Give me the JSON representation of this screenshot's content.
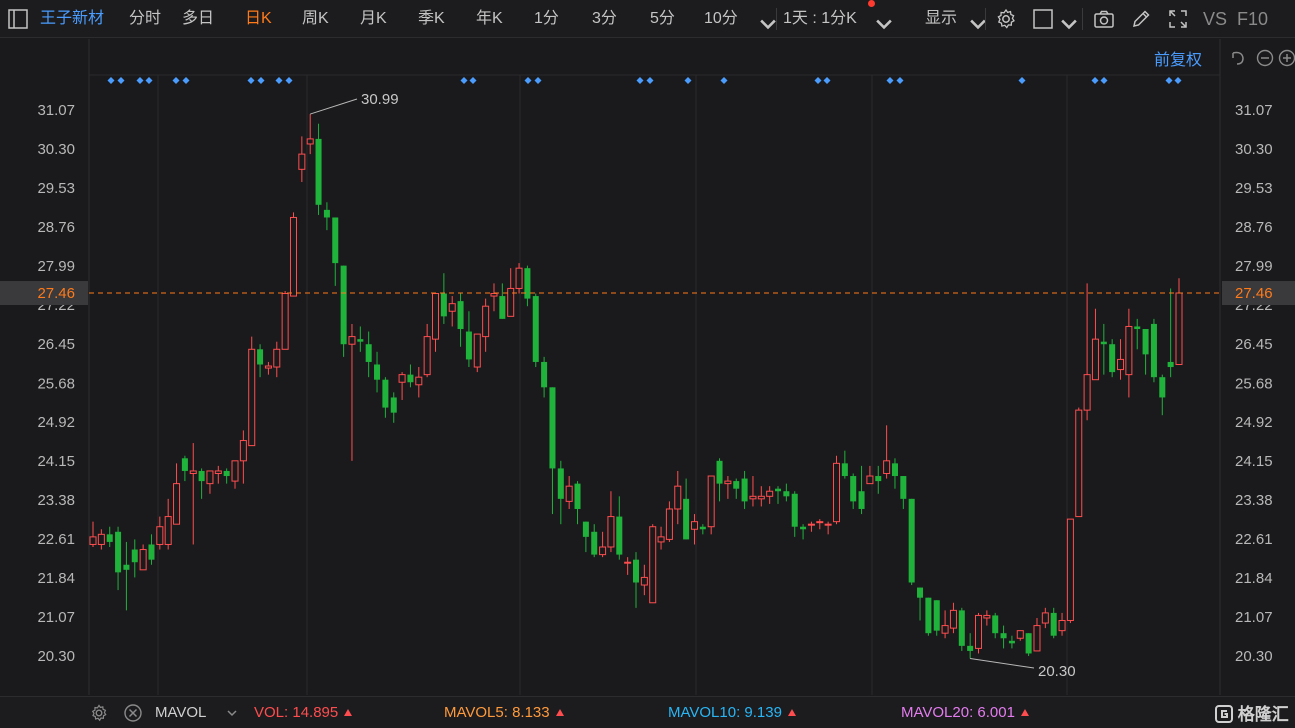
{
  "toolbar": {
    "stock_name": "王子新材",
    "tabs": [
      "分时",
      "多日",
      "日K",
      "周K",
      "月K",
      "季K",
      "年K",
      "1分",
      "3分",
      "5分",
      "10分"
    ],
    "active_tab": "日K",
    "period_select": "1天 : 1分K",
    "display_label": "显示",
    "vs_label": "VS",
    "f10_label": "F10"
  },
  "subbar": {
    "adjust_label": "前复权"
  },
  "colors": {
    "up": "#ff4d4f",
    "down": "#1fb33c",
    "accent": "#4a9cff",
    "active": "#ff7a1a",
    "price_line": "#ff7a1a"
  },
  "chart_data": {
    "type": "candlestick",
    "y_ticks": [
      "31.07",
      "30.30",
      "29.53",
      "28.76",
      "27.99",
      "27.22",
      "26.45",
      "25.68",
      "24.92",
      "24.15",
      "23.38",
      "22.61",
      "21.84",
      "21.07",
      "20.30"
    ],
    "ylim": [
      19.77,
      31.82
    ],
    "current_price": "27.46",
    "high_label": "30.99",
    "low_label": "20.30",
    "candles": [
      [
        22.5,
        22.65,
        22.45,
        22.95
      ],
      [
        22.5,
        22.7,
        22.4,
        22.8
      ],
      [
        22.7,
        22.55,
        22.45,
        22.85
      ],
      [
        22.75,
        21.95,
        21.6,
        22.85
      ],
      [
        22.1,
        22.0,
        21.2,
        22.55
      ],
      [
        22.4,
        22.15,
        21.85,
        22.6
      ],
      [
        22.0,
        22.4,
        22.0,
        22.5
      ],
      [
        22.5,
        22.2,
        22.1,
        22.7
      ],
      [
        22.5,
        22.85,
        22.4,
        23.05
      ],
      [
        22.5,
        23.05,
        22.4,
        23.4
      ],
      [
        22.9,
        23.7,
        22.9,
        24.1
      ],
      [
        24.2,
        23.95,
        23.75,
        24.25
      ],
      [
        23.9,
        23.95,
        22.5,
        24.5
      ],
      [
        23.95,
        23.75,
        23.4,
        24.0
      ],
      [
        23.7,
        23.95,
        23.5,
        23.95
      ],
      [
        23.9,
        23.95,
        23.7,
        24.05
      ],
      [
        23.95,
        23.85,
        23.7,
        24.0
      ],
      [
        23.75,
        24.15,
        23.6,
        24.15
      ],
      [
        24.15,
        24.55,
        23.7,
        24.75
      ],
      [
        24.45,
        26.35,
        24.45,
        26.6
      ],
      [
        26.35,
        26.05,
        25.8,
        26.45
      ],
      [
        25.98,
        26.02,
        25.85,
        26.1
      ],
      [
        26.0,
        26.35,
        25.8,
        26.5
      ],
      [
        26.35,
        27.45,
        26.35,
        27.5
      ],
      [
        27.4,
        28.95,
        27.4,
        29.05
      ],
      [
        29.9,
        30.2,
        29.65,
        30.55
      ],
      [
        30.4,
        30.5,
        30.2,
        30.99
      ],
      [
        30.5,
        29.2,
        29.0,
        30.8
      ],
      [
        29.1,
        28.95,
        28.7,
        29.25
      ],
      [
        28.95,
        28.05,
        27.6,
        28.95
      ],
      [
        28.0,
        26.45,
        26.2,
        28.0
      ],
      [
        26.45,
        26.6,
        24.15,
        26.85
      ],
      [
        26.55,
        26.5,
        26.3,
        26.8
      ],
      [
        26.45,
        26.1,
        25.8,
        26.7
      ],
      [
        26.05,
        25.75,
        25.5,
        26.3
      ],
      [
        25.75,
        25.2,
        25.0,
        25.8
      ],
      [
        25.4,
        25.1,
        24.9,
        25.5
      ],
      [
        25.7,
        25.85,
        25.35,
        25.9
      ],
      [
        25.85,
        25.7,
        25.6,
        26.05
      ],
      [
        25.65,
        25.8,
        25.4,
        26.0
      ],
      [
        25.85,
        26.6,
        25.8,
        26.85
      ],
      [
        26.55,
        27.45,
        26.3,
        27.45
      ],
      [
        27.45,
        27.0,
        26.85,
        27.85
      ],
      [
        27.1,
        27.25,
        26.8,
        27.4
      ],
      [
        27.3,
        26.75,
        26.4,
        27.45
      ],
      [
        26.7,
        26.15,
        26.0,
        27.1
      ],
      [
        26.0,
        26.65,
        25.9,
        26.65
      ],
      [
        26.6,
        27.2,
        26.3,
        27.35
      ],
      [
        27.4,
        27.45,
        27.1,
        27.65
      ],
      [
        27.4,
        26.95,
        26.95,
        27.65
      ],
      [
        27.0,
        27.55,
        27.0,
        27.95
      ],
      [
        27.55,
        27.95,
        27.45,
        28.05
      ],
      [
        27.95,
        27.35,
        27.2,
        28.0
      ],
      [
        27.4,
        26.1,
        26.0,
        27.45
      ],
      [
        26.1,
        25.6,
        25.4,
        26.2
      ],
      [
        25.6,
        24.0,
        23.1,
        25.6
      ],
      [
        24.0,
        23.4,
        22.9,
        24.15
      ],
      [
        23.35,
        23.65,
        23.2,
        23.85
      ],
      [
        23.7,
        23.2,
        22.9,
        23.75
      ],
      [
        22.95,
        22.65,
        22.35,
        22.95
      ],
      [
        22.75,
        22.3,
        22.25,
        22.9
      ],
      [
        22.3,
        22.45,
        22.25,
        22.75
      ],
      [
        22.45,
        23.05,
        22.35,
        23.55
      ],
      [
        23.05,
        22.3,
        22.2,
        23.45
      ],
      [
        22.15,
        22.15,
        21.9,
        22.25
      ],
      [
        22.2,
        21.75,
        21.25,
        22.35
      ],
      [
        21.7,
        21.85,
        21.5,
        22.1
      ],
      [
        21.35,
        22.85,
        21.35,
        22.9
      ],
      [
        22.55,
        22.65,
        22.4,
        22.85
      ],
      [
        22.6,
        23.2,
        22.55,
        23.35
      ],
      [
        23.2,
        23.65,
        22.9,
        23.95
      ],
      [
        23.4,
        22.6,
        22.6,
        23.8
      ],
      [
        22.8,
        22.95,
        22.5,
        23.1
      ],
      [
        22.85,
        22.8,
        22.7,
        22.9
      ],
      [
        22.85,
        23.85,
        22.7,
        23.85
      ],
      [
        24.15,
        23.7,
        23.35,
        24.2
      ],
      [
        23.7,
        23.75,
        23.4,
        23.85
      ],
      [
        23.75,
        23.6,
        23.4,
        23.8
      ],
      [
        23.8,
        23.35,
        23.2,
        23.95
      ],
      [
        23.4,
        23.45,
        23.25,
        23.85
      ],
      [
        23.4,
        23.45,
        23.25,
        23.65
      ],
      [
        23.45,
        23.55,
        23.3,
        23.65
      ],
      [
        23.6,
        23.55,
        23.3,
        23.65
      ],
      [
        23.55,
        23.45,
        23.35,
        23.7
      ],
      [
        23.5,
        22.85,
        22.65,
        23.55
      ],
      [
        22.85,
        22.8,
        22.6,
        22.9
      ],
      [
        22.9,
        22.9,
        22.75,
        22.95
      ],
      [
        22.95,
        22.95,
        22.8,
        23.0
      ],
      [
        22.9,
        22.9,
        22.7,
        22.95
      ],
      [
        22.95,
        24.1,
        22.9,
        24.25
      ],
      [
        24.1,
        23.85,
        23.8,
        24.35
      ],
      [
        23.85,
        23.35,
        23.2,
        23.9
      ],
      [
        23.55,
        23.2,
        23.1,
        24.05
      ],
      [
        23.7,
        23.85,
        23.7,
        24.05
      ],
      [
        23.85,
        23.75,
        23.5,
        24.05
      ],
      [
        23.9,
        24.15,
        23.8,
        24.85
      ],
      [
        24.1,
        23.85,
        23.6,
        24.2
      ],
      [
        23.85,
        23.4,
        23.2,
        23.85
      ],
      [
        23.4,
        21.75,
        21.7,
        23.4
      ],
      [
        21.65,
        21.45,
        21.0,
        21.65
      ],
      [
        21.45,
        20.75,
        20.7,
        21.45
      ],
      [
        21.4,
        20.8,
        20.7,
        21.4
      ],
      [
        20.75,
        20.9,
        20.65,
        21.2
      ],
      [
        20.85,
        21.2,
        20.75,
        21.35
      ],
      [
        21.2,
        20.5,
        20.4,
        21.25
      ],
      [
        20.5,
        20.4,
        20.25,
        20.75
      ],
      [
        20.45,
        21.1,
        20.35,
        21.15
      ],
      [
        21.05,
        21.1,
        20.9,
        21.2
      ],
      [
        21.1,
        20.75,
        20.65,
        21.15
      ],
      [
        20.75,
        20.65,
        20.45,
        20.9
      ],
      [
        20.6,
        20.55,
        20.45,
        20.7
      ],
      [
        20.65,
        20.8,
        20.6,
        20.8
      ],
      [
        20.75,
        20.35,
        20.3,
        20.75
      ],
      [
        20.4,
        20.9,
        20.4,
        21.05
      ],
      [
        20.95,
        21.15,
        20.85,
        21.25
      ],
      [
        21.15,
        20.7,
        20.65,
        21.25
      ],
      [
        20.8,
        21.0,
        20.7,
        21.15
      ],
      [
        21.0,
        23.0,
        20.95,
        23.0
      ],
      [
        23.05,
        25.15,
        23.05,
        25.2
      ],
      [
        25.15,
        25.85,
        24.95,
        27.65
      ],
      [
        25.75,
        26.55,
        25.85,
        27.15
      ],
      [
        26.5,
        26.45,
        25.85,
        26.85
      ],
      [
        26.45,
        25.9,
        25.8,
        26.55
      ],
      [
        25.95,
        26.15,
        25.75,
        26.55
      ],
      [
        25.85,
        26.8,
        25.4,
        27.15
      ],
      [
        26.8,
        26.75,
        26.35,
        26.95
      ],
      [
        26.75,
        26.25,
        25.85,
        26.75
      ],
      [
        26.85,
        25.8,
        25.7,
        26.95
      ],
      [
        25.8,
        25.4,
        25.05,
        25.85
      ],
      [
        26.1,
        26.0,
        25.8,
        27.55
      ],
      [
        26.05,
        27.46,
        26.05,
        27.75
      ]
    ],
    "markers_x": [
      111,
      121,
      140,
      149,
      176,
      186,
      251,
      261,
      279,
      289,
      464,
      473,
      528,
      538,
      640,
      650,
      688,
      724,
      818,
      827,
      890,
      900,
      1022,
      1095,
      1104,
      1169,
      1178
    ]
  },
  "bottom": {
    "mavol_label": "MAVOL",
    "vol_label": "VOL: 14.895",
    "mavol5_label": "MAVOL5: 8.133",
    "mavol10_label": "MAVOL10: 9.139",
    "mavol20_label": "MAVOL20: 6.001",
    "watermark": "格隆汇"
  }
}
